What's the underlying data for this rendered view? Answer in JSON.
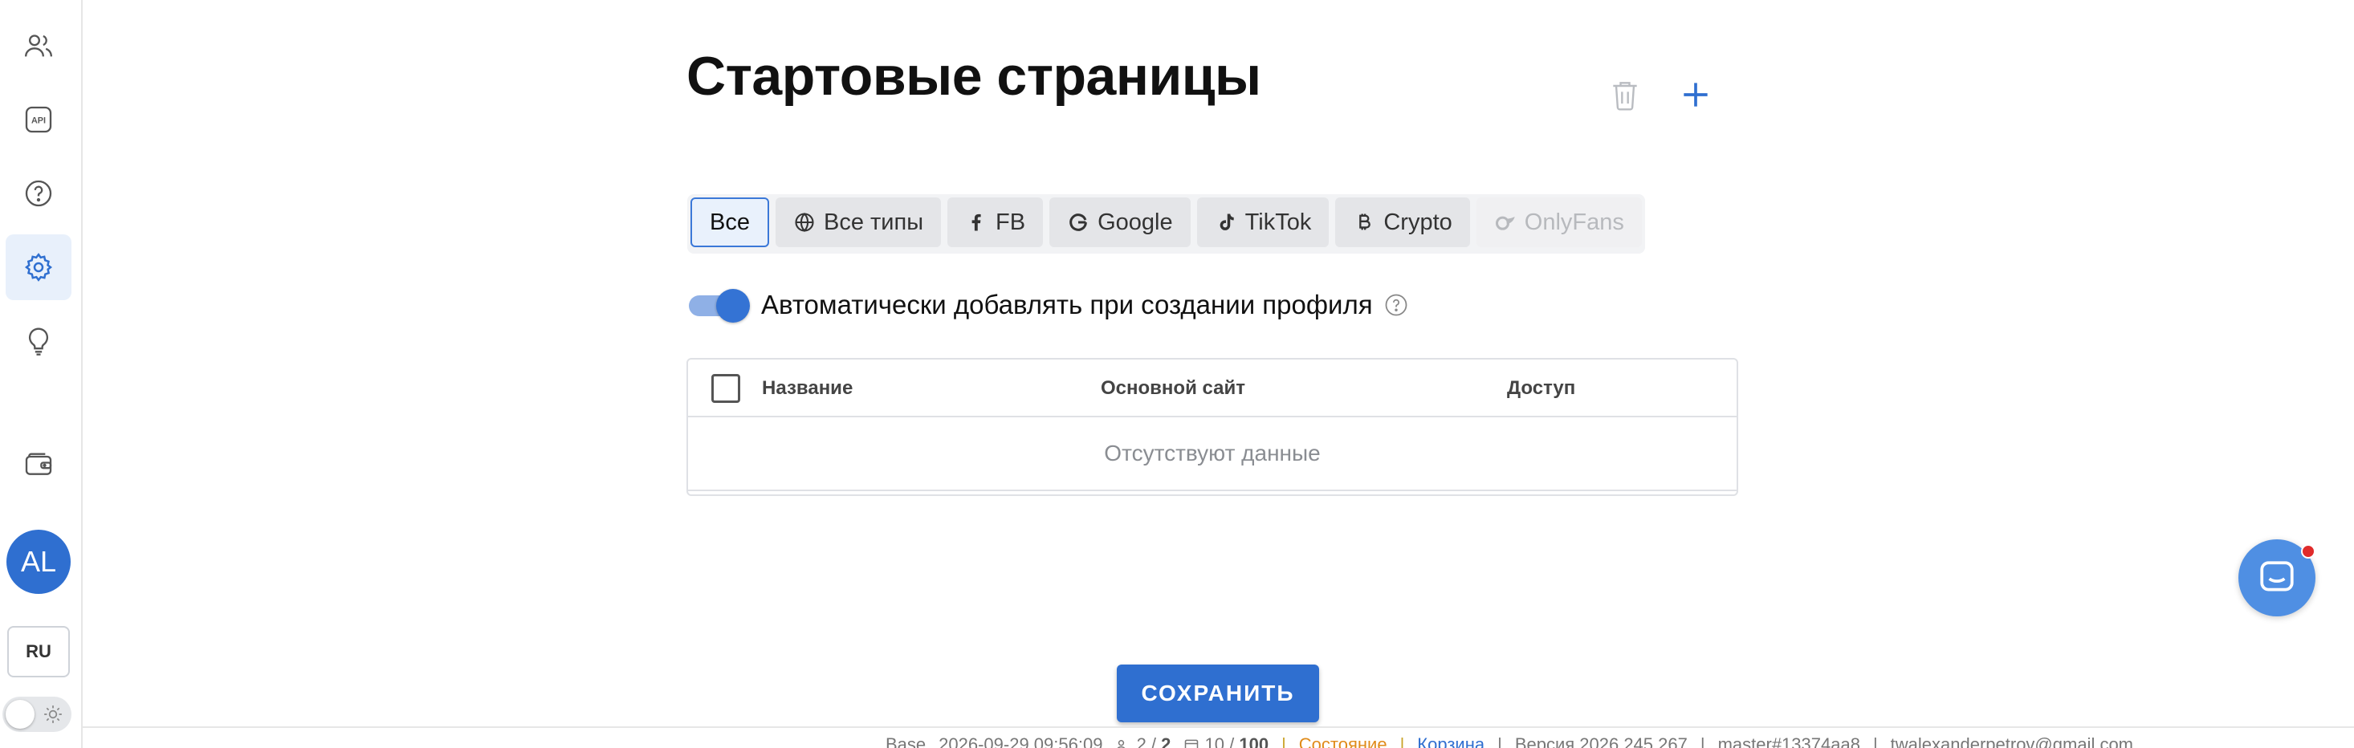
{
  "sidebar": {
    "items": [
      {
        "icon": "users-icon"
      },
      {
        "icon": "api-icon",
        "label": "API"
      },
      {
        "icon": "help-icon"
      },
      {
        "icon": "gear-icon",
        "active": true
      },
      {
        "icon": "lightbulb-icon"
      },
      {
        "icon": "wallet-icon"
      }
    ],
    "avatar_initials": "AL",
    "language": "RU"
  },
  "page": {
    "title": "Стартовые страницы"
  },
  "tabs": [
    {
      "label": "Все",
      "active": true
    },
    {
      "label": "Все типы",
      "icon": "globe-icon"
    },
    {
      "label": "FB",
      "icon": "facebook-icon"
    },
    {
      "label": "Google",
      "icon": "google-icon"
    },
    {
      "label": "TikTok",
      "icon": "tiktok-icon"
    },
    {
      "label": "Crypto",
      "icon": "bitcoin-icon"
    },
    {
      "label": "OnlyFans",
      "icon": "onlyfans-icon",
      "disabled": true
    }
  ],
  "auto_add": {
    "label": "Автоматически добавлять при создании профиля",
    "enabled": true
  },
  "table": {
    "columns": [
      "Название",
      "Основной сайт",
      "Доступ"
    ],
    "empty_text": "Отсутствуют данные"
  },
  "save_label": "СОХРАНИТЬ",
  "status_bar": {
    "env": "Base",
    "datetime": "2026-09-29 09:56:09",
    "users": "2 / ",
    "users_max": "2",
    "profiles": "10 / ",
    "profiles_max": "100",
    "state_link": "Состояние",
    "trash_link": "Корзина",
    "version": "Версия 2026.245.267",
    "branch": "master#13374aa8",
    "email": "twalexanderpetrov@gmail.com"
  },
  "colors": {
    "accent": "#2f6fd0",
    "active_nav_bg": "#e8f0fb",
    "status_orange": "#e08b1a"
  }
}
